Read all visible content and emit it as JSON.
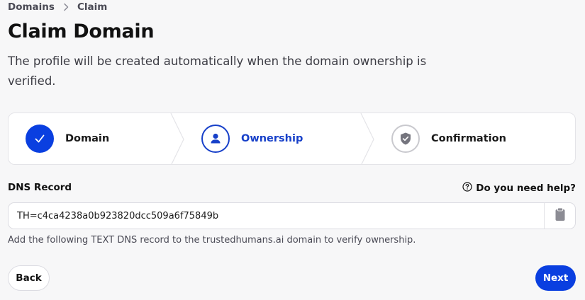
{
  "breadcrumb": {
    "items": [
      "Domains",
      "Claim"
    ]
  },
  "page": {
    "title": "Claim Domain",
    "subtitle": "The profile will be created automatically when the domain ownership is verified."
  },
  "stepper": {
    "steps": [
      {
        "label": "Domain",
        "state": "completed",
        "icon": "check-icon"
      },
      {
        "label": "Ownership",
        "state": "active",
        "icon": "person-icon"
      },
      {
        "label": "Confirmation",
        "state": "pending",
        "icon": "shield-check-icon"
      }
    ]
  },
  "dns": {
    "label": "DNS Record",
    "help_text": "Do you need help?",
    "value": "TH=c4ca4238a0b923820dcc509a6f75849b",
    "hint": "Add the following TEXT DNS record to the trustedhumans.ai domain to verify ownership."
  },
  "actions": {
    "back_label": "Back",
    "next_label": "Next"
  },
  "colors": {
    "primary": "#0a3fe0",
    "active_text": "#1740c9",
    "background": "#f7f7f8"
  }
}
